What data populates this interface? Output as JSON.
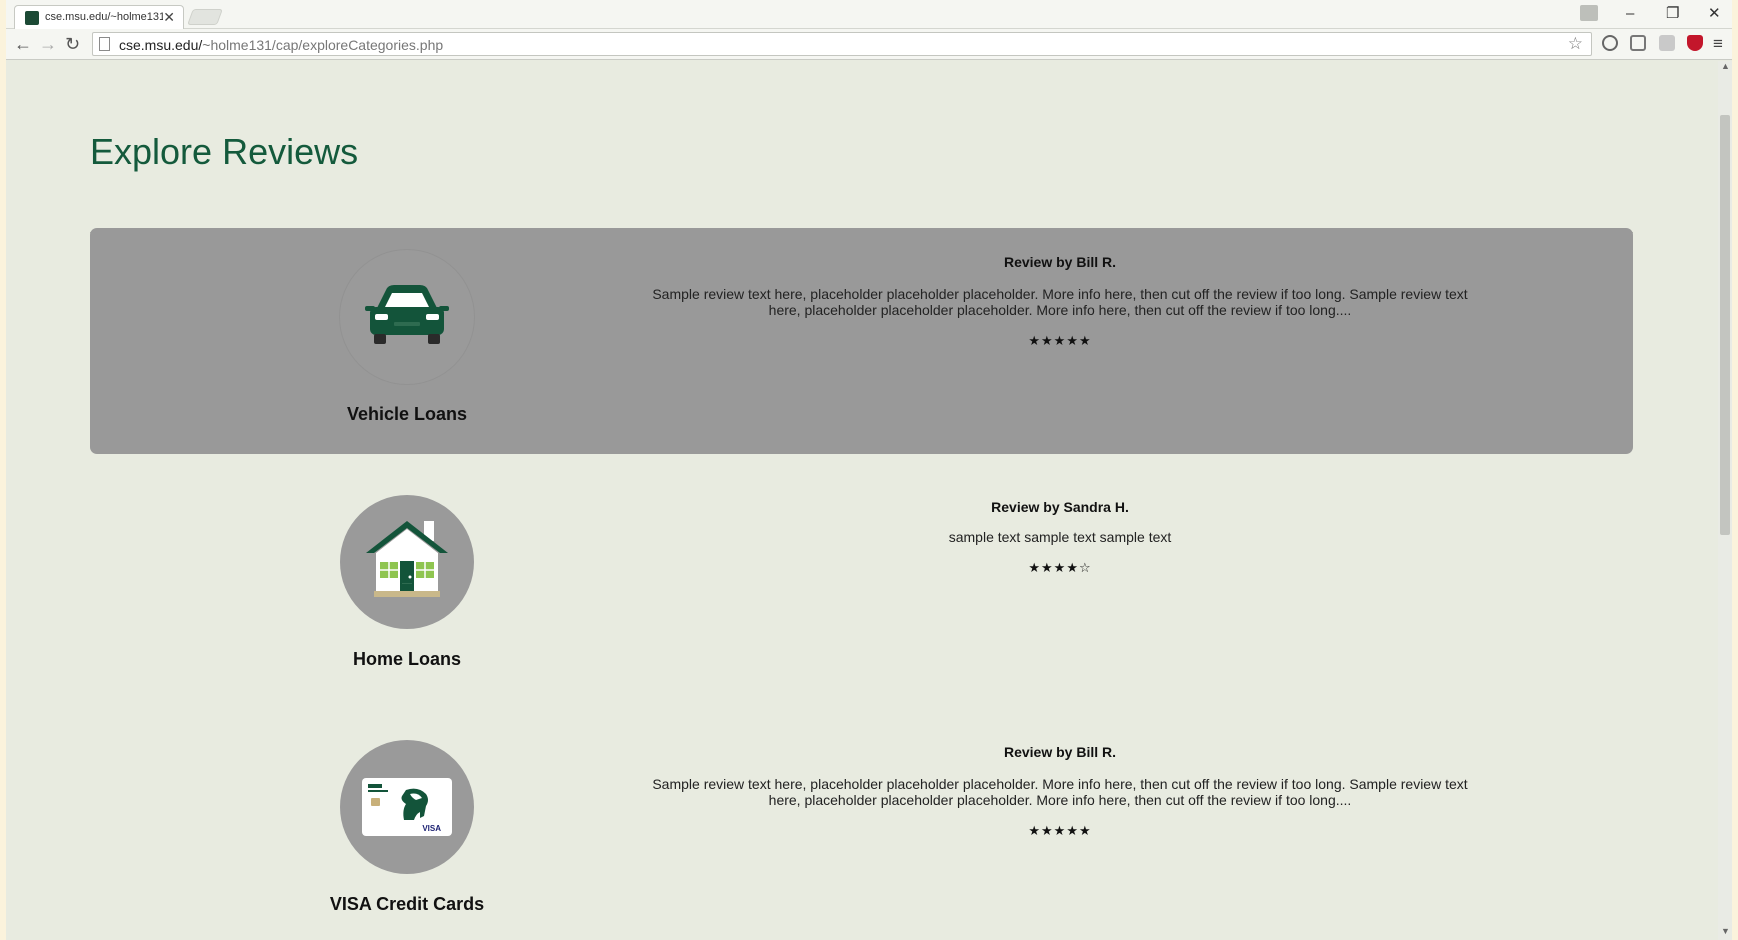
{
  "browser": {
    "tab_title": "cse.msu.edu/~holme131/",
    "tab_close": "✕",
    "url_host": "cse.msu.edu/",
    "url_path": "~holme131/cap/exploreCategories.php",
    "back": "←",
    "forward": "→",
    "reload": "↻",
    "star": "☆",
    "menu": "≡",
    "minimize": "–",
    "maximize": "❐",
    "close": "✕"
  },
  "page": {
    "title": "Explore Reviews",
    "accent_color": "#145a3c",
    "highlight_color": "#999999",
    "background": "#e8ebe0"
  },
  "categories": [
    {
      "label": "Vehicle Loans",
      "icon": "car-icon",
      "review_author": "Review by Bill R.",
      "review_text": "Sample review text here, placeholder placeholder placeholder. More info here, then cut off the review if too long. Sample review text here, placeholder placeholder placeholder. More info here, then cut off the review if too long....",
      "rating": 5,
      "stars": "★★★★★"
    },
    {
      "label": "Home Loans",
      "icon": "house-icon",
      "review_author": "Review by Sandra H.",
      "review_text": "sample text sample text sample text",
      "rating": 4,
      "stars": "★★★★☆"
    },
    {
      "label": "VISA Credit Cards",
      "icon": "credit-card-icon",
      "review_author": "Review by Bill R.",
      "review_text": "Sample review text here, placeholder placeholder placeholder. More info here, then cut off the review if too long. Sample review text here, placeholder placeholder placeholder. More info here, then cut off the review if too long....",
      "rating": 5,
      "stars": "★★★★★",
      "card_brand": "VISA"
    }
  ]
}
